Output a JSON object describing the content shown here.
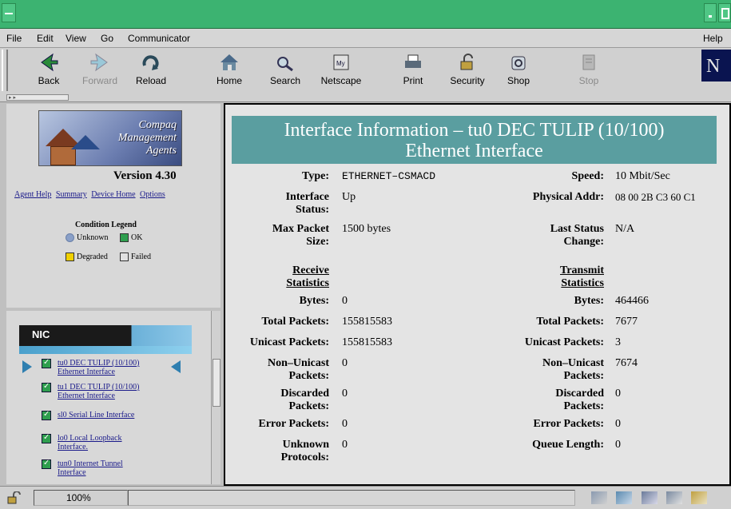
{
  "menu": {
    "file": "File",
    "edit": "Edit",
    "view": "View",
    "go": "Go",
    "communicator": "Communicator",
    "help": "Help"
  },
  "toolbar": {
    "back": "Back",
    "forward": "Forward",
    "reload": "Reload",
    "home": "Home",
    "search": "Search",
    "netscape": "Netscape",
    "print": "Print",
    "security": "Security",
    "shop": "Shop",
    "stop": "Stop",
    "netscape_logo": "N"
  },
  "left_top": {
    "logo_line1": "Compaq",
    "logo_line2": "Management",
    "logo_line3": "Agents",
    "version": "Version 4.30",
    "links": [
      "Agent Help",
      "Summary",
      "Device Home",
      "Options"
    ],
    "legend_title": "Condition Legend",
    "legend": {
      "unknown": "Unknown",
      "ok": "OK",
      "degraded": "Degraded",
      "failed": "Failed"
    }
  },
  "nic": {
    "title": "NIC",
    "items": [
      {
        "line1": "tu0 DEC TULIP (10/100)",
        "line2": "Ethernet Interface"
      },
      {
        "line1": "tu1 DEC TULIP (10/100)",
        "line2": "Ethernet Interface"
      },
      {
        "line1": "sl0 Serial Line Interface",
        "line2": ""
      },
      {
        "line1": "lo0 Local Loopback",
        "line2": "Interface."
      },
      {
        "line1": "tun0 Internet Tunnel",
        "line2": "Interface"
      }
    ]
  },
  "main": {
    "title_line1": "Interface Information – tu0 DEC TULIP (10/100)",
    "title_line2": "Ethernet Interface",
    "type_label": "Type:",
    "type_value": "ETHERNET–CSMACD",
    "speed_label": "Speed:",
    "speed_value": "10 Mbit/Sec",
    "ifstatus_label1": "Interface",
    "ifstatus_label2": "Status:",
    "ifstatus_value": "Up",
    "phys_label": "Physical Addr:",
    "phys_value": "08 00 2B C3 60 C1",
    "maxpkt_label1": "Max Packet",
    "maxpkt_label2": "Size:",
    "maxpkt_value": "1500 bytes",
    "laststatus_label1": "Last Status",
    "laststatus_label2": "Change:",
    "laststatus_value": "N/A",
    "recv_header1": "Receive",
    "recv_header2": "Statistics",
    "xmit_header1": "Transmit",
    "xmit_header2": "Statistics",
    "receive": {
      "bytes_label": "Bytes:",
      "bytes": "0",
      "total_label": "Total Packets:",
      "total": "155815583",
      "unicast_label": "Unicast Packets:",
      "unicast": "155815583",
      "nonunicast_label1": "Non–Unicast",
      "nonunicast_label2": "Packets:",
      "nonunicast": "0",
      "discarded_label1": "Discarded",
      "discarded_label2": "Packets:",
      "discarded": "0",
      "error_label": "Error Packets:",
      "error": "0",
      "unknown_label1": "Unknown",
      "unknown_label2": "Protocols:",
      "unknown": "0"
    },
    "transmit": {
      "bytes_label": "Bytes:",
      "bytes": "464466",
      "total_label": "Total Packets:",
      "total": "7677",
      "unicast_label": "Unicast Packets:",
      "unicast": "3",
      "nonunicast_label1": "Non–Unicast",
      "nonunicast_label2": "Packets:",
      "nonunicast": "7674",
      "discarded_label1": "Discarded",
      "discarded_label2": "Packets:",
      "discarded": "0",
      "error_label": "Error Packets:",
      "error": "0",
      "queue_label": "Queue Length:",
      "queue": "0"
    }
  },
  "status": {
    "progress": "100%"
  }
}
